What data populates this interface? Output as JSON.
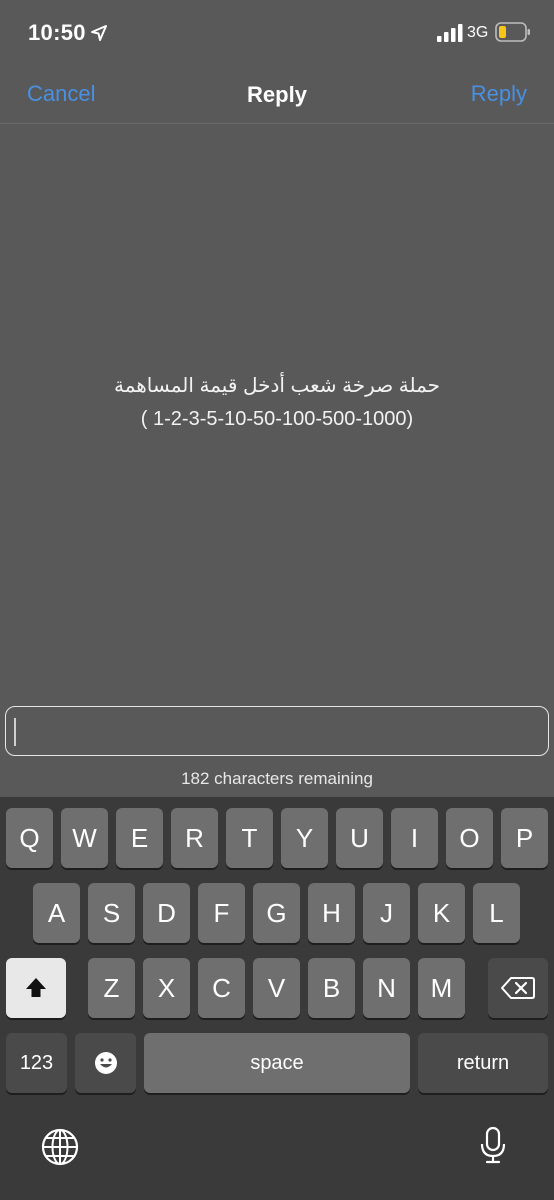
{
  "status": {
    "time": "10:50",
    "network": "3G",
    "icons": [
      "location-arrow-icon",
      "signal-bars-icon",
      "battery-low-icon"
    ],
    "battery_color": "#f5c518"
  },
  "nav": {
    "cancel_label": "Cancel",
    "title": "Reply",
    "reply_label": "Reply",
    "accent_color": "#4a90e2"
  },
  "message": {
    "line1": "حملة صرخة شعب أدخل قيمة المساهمة",
    "line2": "(1-2-3-5-10-50-100-500-1000 )"
  },
  "input": {
    "value": "",
    "remaining": "182 characters remaining"
  },
  "keyboard": {
    "row1": [
      "Q",
      "W",
      "E",
      "R",
      "T",
      "Y",
      "U",
      "I",
      "O",
      "P"
    ],
    "row2": [
      "A",
      "S",
      "D",
      "F",
      "G",
      "H",
      "J",
      "K",
      "L"
    ],
    "row3": [
      "Z",
      "X",
      "C",
      "V",
      "B",
      "N",
      "M"
    ],
    "numbers_label": "123",
    "space_label": "space",
    "return_label": "return",
    "icons": [
      "shift-icon",
      "backspace-icon",
      "emoji-icon",
      "globe-icon",
      "microphone-icon"
    ]
  }
}
